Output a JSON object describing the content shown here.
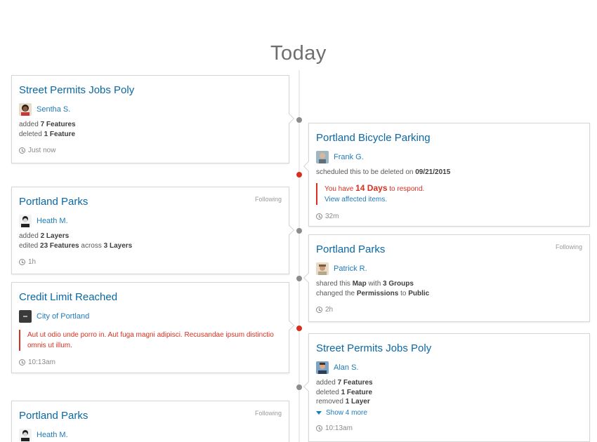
{
  "heading": "Today",
  "colors": {
    "link": "#0a68a3",
    "alert": "#d83020",
    "spine_dot": "#8c8c8c"
  },
  "cards": [
    {
      "title": "Street Permits Jobs Poly",
      "user": "Sentha S.",
      "lines": [
        [
          "added ",
          "7 Features"
        ],
        [
          "deleted ",
          "1 Feature"
        ]
      ],
      "time": "Just now"
    },
    {
      "title": "Portland Bicycle Parking",
      "user": "Frank G.",
      "line_prefix": "scheduled this to be deleted on ",
      "line_date": "09/21/2015",
      "alert_prefix": "You have ",
      "alert_days": "14 Days",
      "alert_suffix": " to respond.",
      "alert_link": "View affected items.",
      "time": "32m"
    },
    {
      "title": "Portland Parks",
      "following": "Following",
      "user": "Heath M.",
      "line1_pre": "added ",
      "line1_b": "2 Layers",
      "line2_pre": "edited ",
      "line2_b1": "23 Features",
      "line2_mid": " across ",
      "line2_b2": "3 Layers",
      "time": "1h"
    },
    {
      "title": "Portland Parks",
      "following": "Following",
      "user": "Patrick R.",
      "line1_pre": "shared this ",
      "line1_b1": "Map",
      "line1_mid": " with ",
      "line1_b2": "3 Groups",
      "line2_pre": "changed the ",
      "line2_b1": "Permissions",
      "line2_mid": " to ",
      "line2_b2": "Public",
      "time": "2h"
    },
    {
      "title": "Credit Limit Reached",
      "user": "City of Portland",
      "alert_text": "Aut ut odio unde porro in. Aut fuga magni adipisci. Recusandae ipsum distinctio omnis ut illum.",
      "time": "10:13am"
    },
    {
      "title": "Street Permits Jobs Poly",
      "user": "Alan S.",
      "lines": [
        [
          "added ",
          "7 Features"
        ],
        [
          "deleted ",
          "1 Feature"
        ],
        [
          "removed ",
          "1 Layer"
        ]
      ],
      "show_more": "Show 4 more",
      "time": "10:13am"
    },
    {
      "title": "Portland Parks",
      "following": "Following",
      "user": "Heath M."
    }
  ]
}
